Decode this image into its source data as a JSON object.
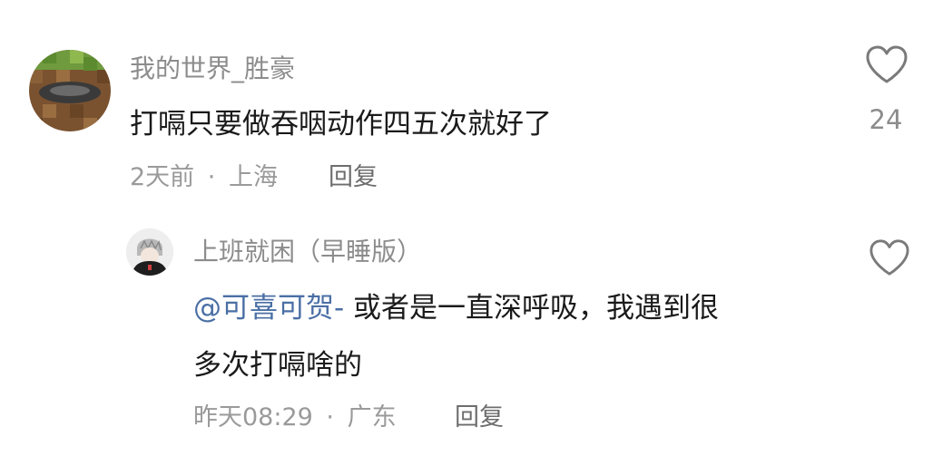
{
  "comments": [
    {
      "username": "我的世界_胜豪",
      "text": "打嗝只要做吞咽动作四五次就好了",
      "time": "2天前",
      "separator": "·",
      "location": "上海",
      "reply_label": "回复",
      "likes": "24"
    }
  ],
  "replies": [
    {
      "username": "上班就困（早睡版）",
      "mention": "@可喜可贺-",
      "text_line1": " 或者是一直深呼吸，我遇到很",
      "text_line2": "多次打嗝啥的",
      "time": "昨天08:29",
      "separator": "·",
      "location": "广东",
      "reply_label": "回复"
    }
  ],
  "icons": {
    "like": "heart-outline-icon"
  },
  "colors": {
    "username": "#8c8c8c",
    "text": "#1a1a1a",
    "mention": "#4a6fa5",
    "meta": "#9a9a9a"
  }
}
